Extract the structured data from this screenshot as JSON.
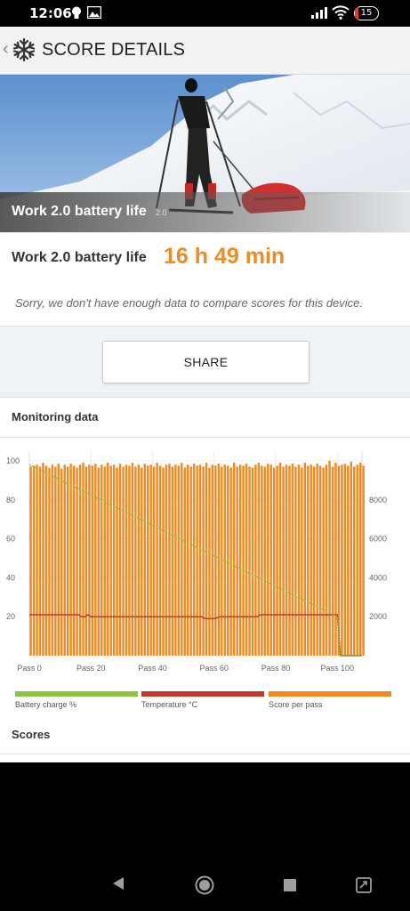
{
  "status": {
    "time": "12:06",
    "battery": "15"
  },
  "header": {
    "title": "SCORE DETAILS"
  },
  "hero": {
    "title": "Work 2.0 battery life",
    "version": "2.0"
  },
  "result": {
    "label": "Work 2.0 battery life",
    "value": "16 h 49 min"
  },
  "compare": {
    "message": "Sorry, we don't have enough data to compare scores for this device."
  },
  "share": {
    "label": "SHARE"
  },
  "monitoring": {
    "title": "Monitoring data"
  },
  "scores": {
    "title": "Scores"
  },
  "colors": {
    "accent": "#f28a22",
    "battery": "#8cc63f",
    "temperature": "#c0392b",
    "score": "#f28a22"
  },
  "chart_data": {
    "type": "bar",
    "x_tick_labels": [
      "Pass 0",
      "Pass 20",
      "Pass 40",
      "Pass 60",
      "Pass 80",
      "Pass 100"
    ],
    "left_axis": {
      "ticks": [
        "100",
        "80",
        "60",
        "40",
        "20"
      ],
      "ylim": [
        0,
        105
      ]
    },
    "right_axis": {
      "ticks": [
        "8000",
        "6000",
        "4000",
        "2000"
      ],
      "ylim": [
        0,
        10500
      ]
    },
    "series": [
      {
        "name": "Battery charge %",
        "type": "line",
        "x": [
          0,
          100,
          101,
          102,
          103,
          104,
          105,
          106,
          107,
          108
        ],
        "values": [
          98,
          20,
          0,
          0,
          0,
          0,
          0,
          0,
          0,
          0
        ]
      },
      {
        "name": "Temperature °C",
        "type": "line",
        "x": [
          0,
          16,
          17,
          18,
          19,
          20,
          44,
          56,
          57,
          58,
          59,
          60,
          62,
          74,
          75,
          76,
          100,
          101,
          108
        ],
        "values": [
          21,
          21,
          20,
          20,
          21,
          20,
          20,
          20,
          19,
          19,
          19,
          19,
          20,
          20,
          21,
          21,
          21,
          0,
          0
        ]
      },
      {
        "name": "Score per pass",
        "type": "bar",
        "values": [
          9700,
          9750,
          9800,
          9700,
          9900,
          9750,
          9650,
          9800,
          9700,
          9850,
          9600,
          9800,
          9700,
          9850,
          9750,
          9650,
          9800,
          9900,
          9700,
          9800,
          9750,
          9850,
          9650,
          9800,
          9700,
          9900,
          9750,
          9800,
          9650,
          9850,
          9700,
          9800,
          9750,
          9900,
          9700,
          9800,
          9650,
          9850,
          9750,
          9800,
          9700,
          9900,
          9750,
          9650,
          9800,
          9850,
          9700,
          9800,
          9750,
          9900,
          9650,
          9800,
          9700,
          9850,
          9750,
          9800,
          9700,
          9900,
          9650,
          9800,
          9750,
          9850,
          9700,
          9800,
          9750,
          9650,
          9900,
          9700,
          9800,
          9750,
          9850,
          9700,
          9650,
          9800,
          9900,
          9750,
          9700,
          9850,
          9800,
          9650,
          9750,
          9900,
          9700,
          9800,
          9750,
          9850,
          9700,
          9800,
          9650,
          9900,
          9750,
          9800,
          9700,
          9850,
          9750,
          9650,
          9800,
          10000,
          9700,
          9900,
          9750,
          9800,
          9850,
          9750,
          9950,
          9700,
          9800,
          9900,
          9750
        ]
      }
    ]
  }
}
